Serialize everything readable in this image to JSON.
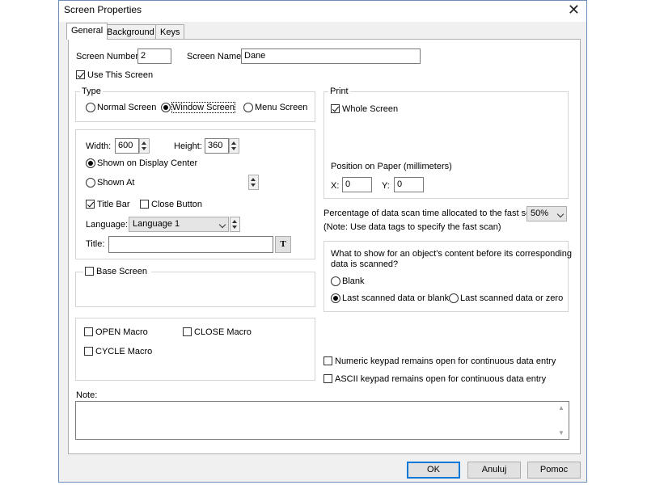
{
  "window": {
    "title": "Screen Properties"
  },
  "tabs": [
    "General",
    "Background",
    "Keys"
  ],
  "screen": {
    "number_label": "Screen Number:",
    "number_value": "2",
    "name_label": "Screen Name:",
    "name_value": "Dane",
    "use_this_screen": "Use This Screen"
  },
  "type": {
    "label": "Type",
    "options": [
      "Normal Screen",
      "Window Screen",
      "Menu Screen"
    ],
    "selected": "Window Screen"
  },
  "print": {
    "label": "Print",
    "whole_screen": "Whole Screen",
    "position_label": "Position on Paper (millimeters)",
    "x_label": "X:",
    "x_value": "0",
    "y_label": "Y:",
    "y_value": "0"
  },
  "window_opts": {
    "width_label": "Width:",
    "width_value": "600",
    "height_label": "Height:",
    "height_value": "360",
    "shown_center": "Shown on Display Center",
    "shown_at": "Shown At",
    "title_bar": "Title Bar",
    "close_button": "Close Button",
    "language_label": "Language:",
    "language_value": "Language 1",
    "title_label": "Title:",
    "title_value": "",
    "title_btn": "T"
  },
  "scan": {
    "pct_label": "Percentage of data scan time allocated to the fast scan:",
    "pct_value": "50%",
    "note": "(Note: Use data tags to specify the fast scan)"
  },
  "content": {
    "question_line1": "What to show for an object's content before its corresponding",
    "question_line2": "data is scanned?",
    "blank": "Blank",
    "last_blank": "Last scanned data or blank",
    "last_zero": "Last scanned data or zero"
  },
  "base_screen": "Base Screen",
  "macros": {
    "open": "OPEN Macro",
    "close": "CLOSE Macro",
    "cycle": "CYCLE Macro"
  },
  "keypads": {
    "numeric": "Numeric keypad remains open for continuous data entry",
    "ascii": "ASCII keypad remains open for continuous data entry"
  },
  "note_label": "Note:",
  "buttons": {
    "ok": "OK",
    "cancel": "Anuluj",
    "help": "Pomoc"
  }
}
